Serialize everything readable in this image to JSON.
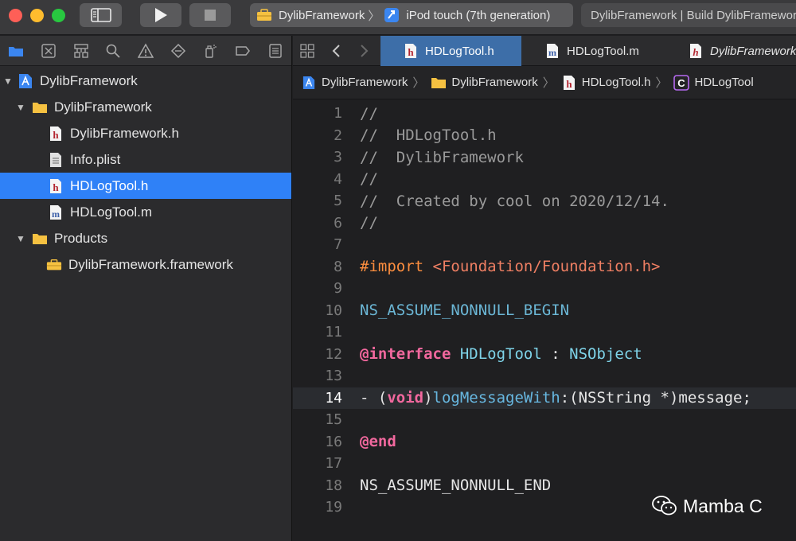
{
  "toolbar": {
    "scheme_target": "DylibFramework",
    "scheme_device": "iPod touch (7th generation)",
    "activity": "DylibFramework | Build DylibFramework"
  },
  "navigator": {
    "tree": [
      {
        "label": "DylibFramework",
        "kind": "project",
        "depth": 0,
        "expanded": true
      },
      {
        "label": "DylibFramework",
        "kind": "folder",
        "depth": 1,
        "expanded": true
      },
      {
        "label": "DylibFramework.h",
        "kind": "header",
        "depth": 2
      },
      {
        "label": "Info.plist",
        "kind": "plist",
        "depth": 2
      },
      {
        "label": "HDLogTool.h",
        "kind": "header",
        "depth": 2,
        "selected": true
      },
      {
        "label": "HDLogTool.m",
        "kind": "impl",
        "depth": 2
      },
      {
        "label": "Products",
        "kind": "folder",
        "depth": 1,
        "expanded": true
      },
      {
        "label": "DylibFramework.framework",
        "kind": "framework",
        "depth": 2
      }
    ]
  },
  "editor": {
    "tabs": [
      {
        "label": "HDLogTool.h",
        "kind": "header",
        "active": true
      },
      {
        "label": "HDLogTool.m",
        "kind": "impl",
        "active": false
      },
      {
        "label": "DylibFramework",
        "kind": "header",
        "active": false
      }
    ],
    "jumpbar": [
      "DylibFramework",
      "DylibFramework",
      "HDLogTool.h",
      "HDLogTool"
    ],
    "current_line": 14,
    "lines": [
      [
        {
          "t": "//",
          "c": "comment"
        }
      ],
      [
        {
          "t": "//  HDLogTool.h",
          "c": "comment"
        }
      ],
      [
        {
          "t": "//  DylibFramework",
          "c": "comment"
        }
      ],
      [
        {
          "t": "//",
          "c": "comment"
        }
      ],
      [
        {
          "t": "//  Created by cool on 2020/12/14.",
          "c": "comment"
        }
      ],
      [
        {
          "t": "//",
          "c": "comment"
        }
      ],
      [],
      [
        {
          "t": "#import ",
          "c": "preproc"
        },
        {
          "t": "<Foundation/Foundation.h>",
          "c": "string"
        }
      ],
      [],
      [
        {
          "t": "NS_ASSUME_NONNULL_BEGIN",
          "c": "macro"
        }
      ],
      [],
      [
        {
          "t": "@interface",
          "c": "keyword"
        },
        {
          "t": " ",
          "c": "plain"
        },
        {
          "t": "HDLogTool",
          "c": "class"
        },
        {
          "t": " : ",
          "c": "plain"
        },
        {
          "t": "NSObject",
          "c": "class"
        }
      ],
      [],
      [
        {
          "t": "- (",
          "c": "plain"
        },
        {
          "t": "void",
          "c": "keyword"
        },
        {
          "t": ")",
          "c": "plain"
        },
        {
          "t": "logMessageWith",
          "c": "method"
        },
        {
          "t": ":(NSString *)message;",
          "c": "plain"
        }
      ],
      [],
      [
        {
          "t": "@end",
          "c": "keyword"
        }
      ],
      [],
      [
        {
          "t": "NS_ASSUME_NONNULL_END",
          "c": "plain"
        }
      ],
      []
    ]
  },
  "watermark": "Mamba C",
  "colors": {
    "selection": "#2f81f7",
    "active_tab": "#3d6ea8",
    "folder": "#f5c141"
  }
}
